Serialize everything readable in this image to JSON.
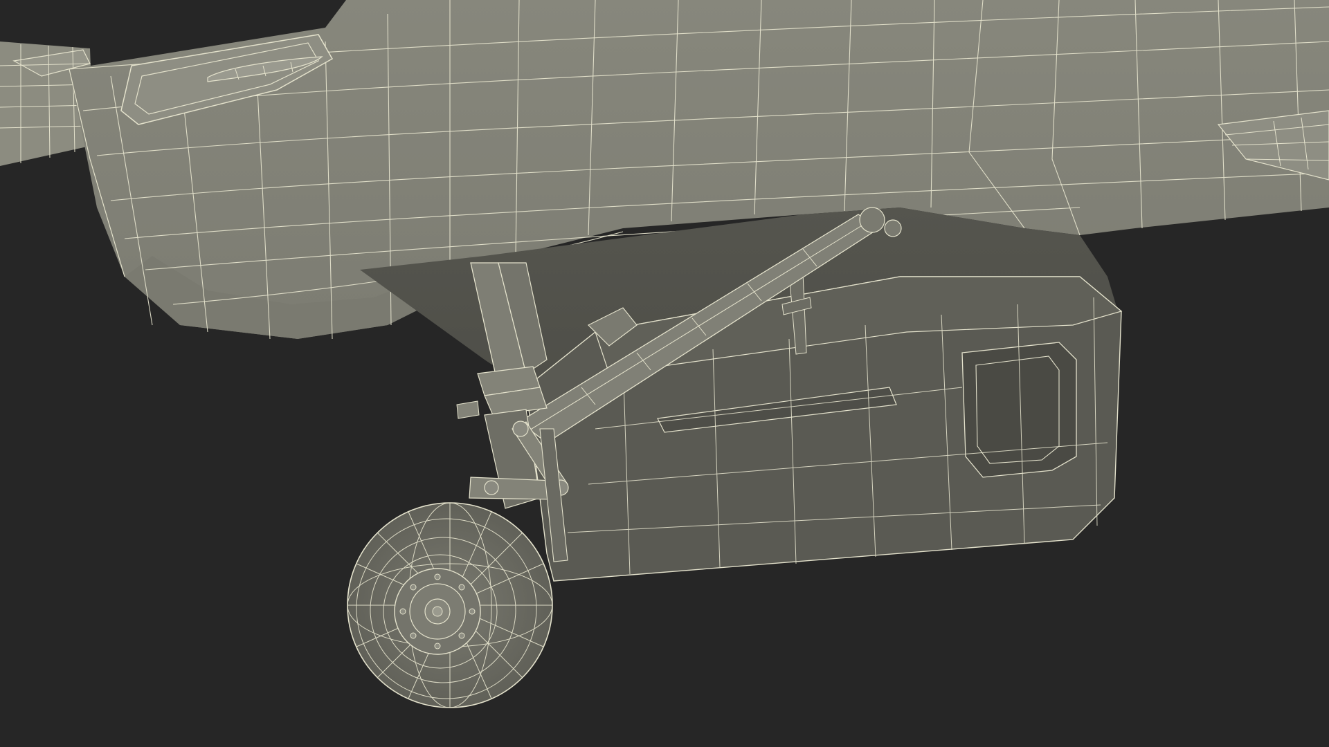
{
  "scene": {
    "background_color": "#262626",
    "surface_color": "#8a8a7e",
    "shadow_surface_color": "#5e5e56",
    "wire_color": "#e4e2cc"
  }
}
